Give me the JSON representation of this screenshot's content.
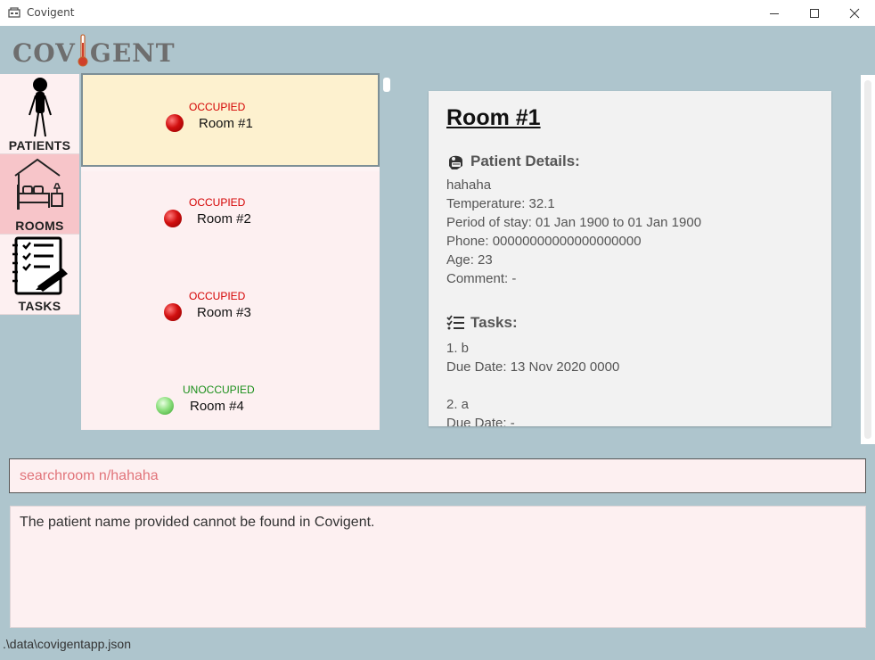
{
  "window": {
    "title": "Covigent"
  },
  "brand": {
    "logo_left": "COV",
    "logo_right": "GENT"
  },
  "nav": {
    "items": [
      {
        "label": "PATIENTS",
        "icon": "patient-icon"
      },
      {
        "label": "ROOMS",
        "icon": "bedroom-icon"
      },
      {
        "label": "TASKS",
        "icon": "checklist-icon"
      }
    ],
    "active": "ROOMS"
  },
  "rooms": [
    {
      "status": "OCCUPIED",
      "name": "Room #1",
      "occupied": true,
      "selected": true
    },
    {
      "status": "OCCUPIED",
      "name": "Room #2",
      "occupied": true,
      "selected": false
    },
    {
      "status": "OCCUPIED",
      "name": "Room #3",
      "occupied": true,
      "selected": false
    },
    {
      "status": "UNOCCUPIED",
      "name": "Room #4",
      "occupied": false,
      "selected": false
    }
  ],
  "detail": {
    "title": "Room #1",
    "patient_heading": "Patient Details:",
    "patient_lines": [
      "hahaha",
      "Temperature: 32.1",
      "Period of stay: 01 Jan 1900 to 01 Jan 1900",
      "Phone: 00000000000000000000",
      "Age: 23",
      "Comment: -"
    ],
    "tasks_heading": "Tasks:",
    "task_lines": [
      "1. b",
      "Due Date: 13 Nov 2020 0000",
      "2. a",
      "Due Date: -"
    ]
  },
  "command": {
    "value": "searchroom n/hahaha"
  },
  "result": {
    "message": "The patient name provided cannot be found in Covigent."
  },
  "status_bar": {
    "path": ".\\data\\covigentapp.json"
  },
  "colors": {
    "background": "#aec5cd",
    "occupied": "#d40000",
    "unoccupied": "#1b8f1b",
    "selected_card": "#fdf1cf",
    "active_nav": "#f7c5c9"
  }
}
